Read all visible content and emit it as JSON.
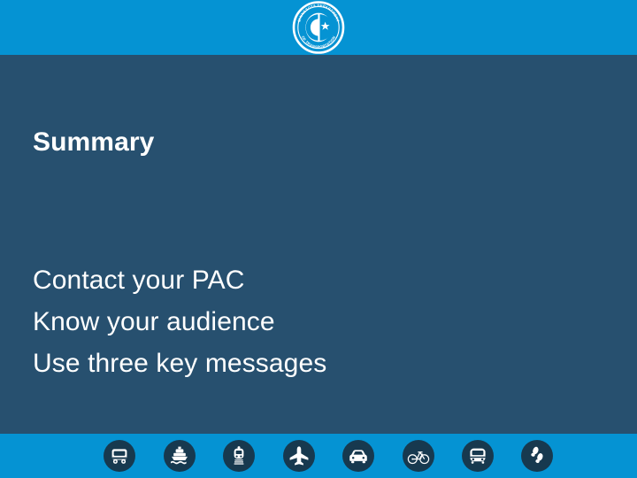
{
  "slide": {
    "title": "Summary",
    "bullets": [
      "Contact your PAC",
      "Know your audience",
      "Use three key messages"
    ]
  },
  "brand": {
    "logo_name": "mndot-seal-logo",
    "logo_alt_text": "Minnesota Department of Transportation",
    "seal_ring_text": "MINNESOTA DEPARTMENT OF TRANSPORTATION"
  },
  "colors": {
    "band_blue": "#0593D3",
    "body_navy": "#27506F",
    "icon_disc": "#17394F",
    "text_white": "#FFFFFF"
  },
  "footer": {
    "icons": [
      {
        "name": "truck-icon",
        "label": "Freight / Truck"
      },
      {
        "name": "ship-icon",
        "label": "Waterways / Ship"
      },
      {
        "name": "rail-icon",
        "label": "Rail / Train"
      },
      {
        "name": "airplane-icon",
        "label": "Aviation / Airplane"
      },
      {
        "name": "car-icon",
        "label": "Roadways / Car"
      },
      {
        "name": "bicycle-icon",
        "label": "Bicycling"
      },
      {
        "name": "bus-icon",
        "label": "Transit / Bus"
      },
      {
        "name": "footprints-icon",
        "label": "Pedestrian / Walking"
      }
    ]
  }
}
